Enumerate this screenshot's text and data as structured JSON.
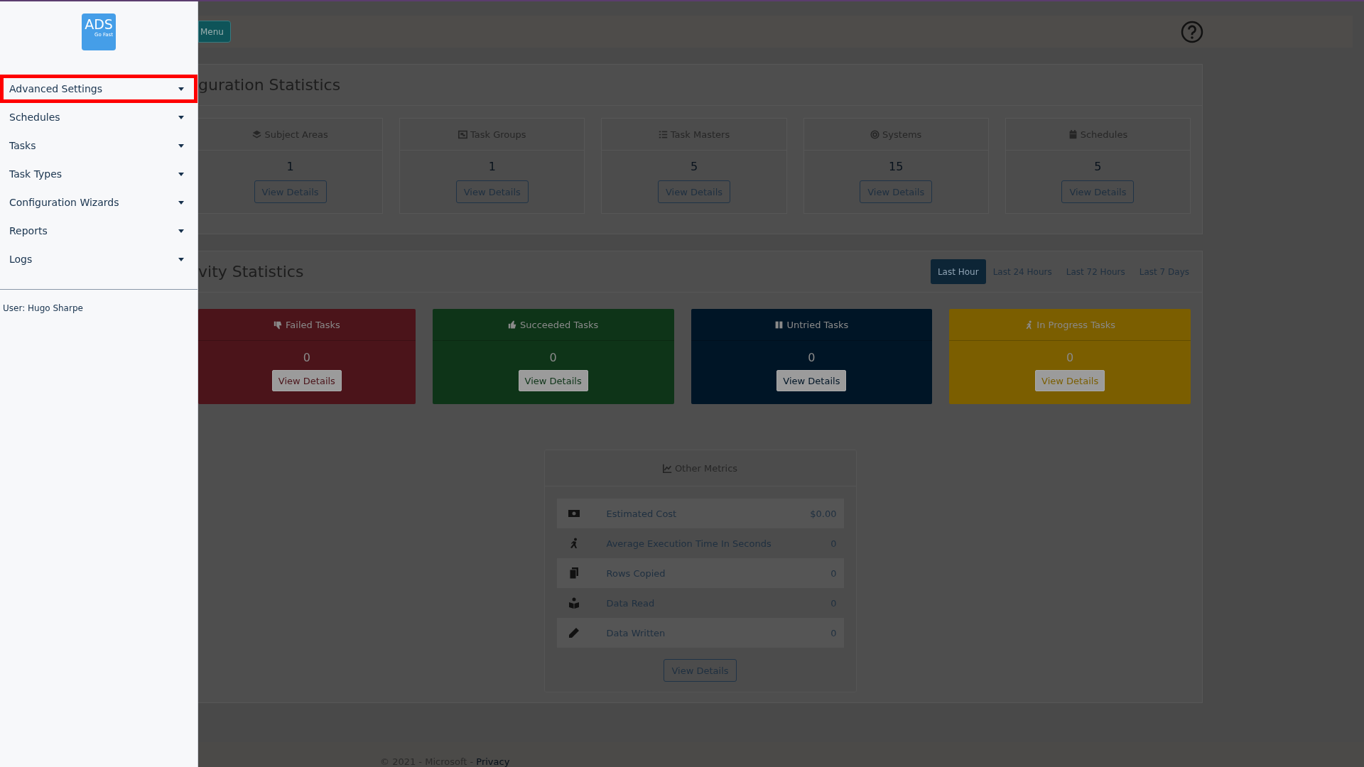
{
  "sidebar": {
    "logo": {
      "title": "ADS",
      "subtitle": "Go Fast"
    },
    "items": [
      {
        "label": "Advanced Settings",
        "selected": true
      },
      {
        "label": "Schedules",
        "selected": false
      },
      {
        "label": "Tasks",
        "selected": false
      },
      {
        "label": "Task Types",
        "selected": false
      },
      {
        "label": "Configuration Wizards",
        "selected": false
      },
      {
        "label": "Reports",
        "selected": false
      },
      {
        "label": "Logs",
        "selected": false
      }
    ],
    "user": "User: Hugo Sharpe"
  },
  "header": {
    "menu_button": "Menu"
  },
  "configuration_statistics": {
    "title": "guration Statistics",
    "cards": [
      {
        "kind": "layers",
        "title": "Subject Areas",
        "value": "1",
        "button": "View Details"
      },
      {
        "kind": "group",
        "title": "Task Groups",
        "value": "1",
        "button": "View Details"
      },
      {
        "kind": "list",
        "title": "Task Masters",
        "value": "5",
        "button": "View Details"
      },
      {
        "kind": "target",
        "title": "Systems",
        "value": "15",
        "button": "View Details"
      },
      {
        "kind": "calendar",
        "title": "Schedules",
        "value": "5",
        "button": "View Details"
      }
    ]
  },
  "activity_statistics": {
    "title": "vity Statistics",
    "ranges": [
      {
        "label": "Last Hour",
        "selected": true
      },
      {
        "label": "Last 24 Hours",
        "selected": false
      },
      {
        "label": "Last 72 Hours",
        "selected": false
      },
      {
        "label": "Last 7 Days",
        "selected": false
      }
    ],
    "cards": [
      {
        "kind": "thumbs-down",
        "title": "Failed Tasks",
        "value": "0",
        "button": "View Details",
        "color": "#4b141a"
      },
      {
        "kind": "thumbs-up",
        "title": "Succeeded Tasks",
        "value": "0",
        "button": "View Details",
        "color": "#0e3418"
      },
      {
        "kind": "pause",
        "title": "Untried Tasks",
        "value": "0",
        "button": "View Details",
        "color": "#001526"
      },
      {
        "kind": "runner",
        "title": "In Progress Tasks",
        "value": "0",
        "button": "View Details",
        "color": "#7b5e00"
      }
    ]
  },
  "other_metrics": {
    "title": "Other Metrics",
    "rows": [
      {
        "kind": "money",
        "label": "Estimated Cost",
        "value": "$0.00"
      },
      {
        "kind": "runner",
        "label": "Average Execution Time In Seconds",
        "value": "0"
      },
      {
        "kind": "copy",
        "label": "Rows Copied",
        "value": "0"
      },
      {
        "kind": "reader",
        "label": "Data Read",
        "value": "0"
      },
      {
        "kind": "pencil",
        "label": "Data Written",
        "value": "0"
      }
    ],
    "button": "View Details"
  },
  "footer": {
    "text": "© 2021 - Microsoft - ",
    "link": "Privacy"
  }
}
